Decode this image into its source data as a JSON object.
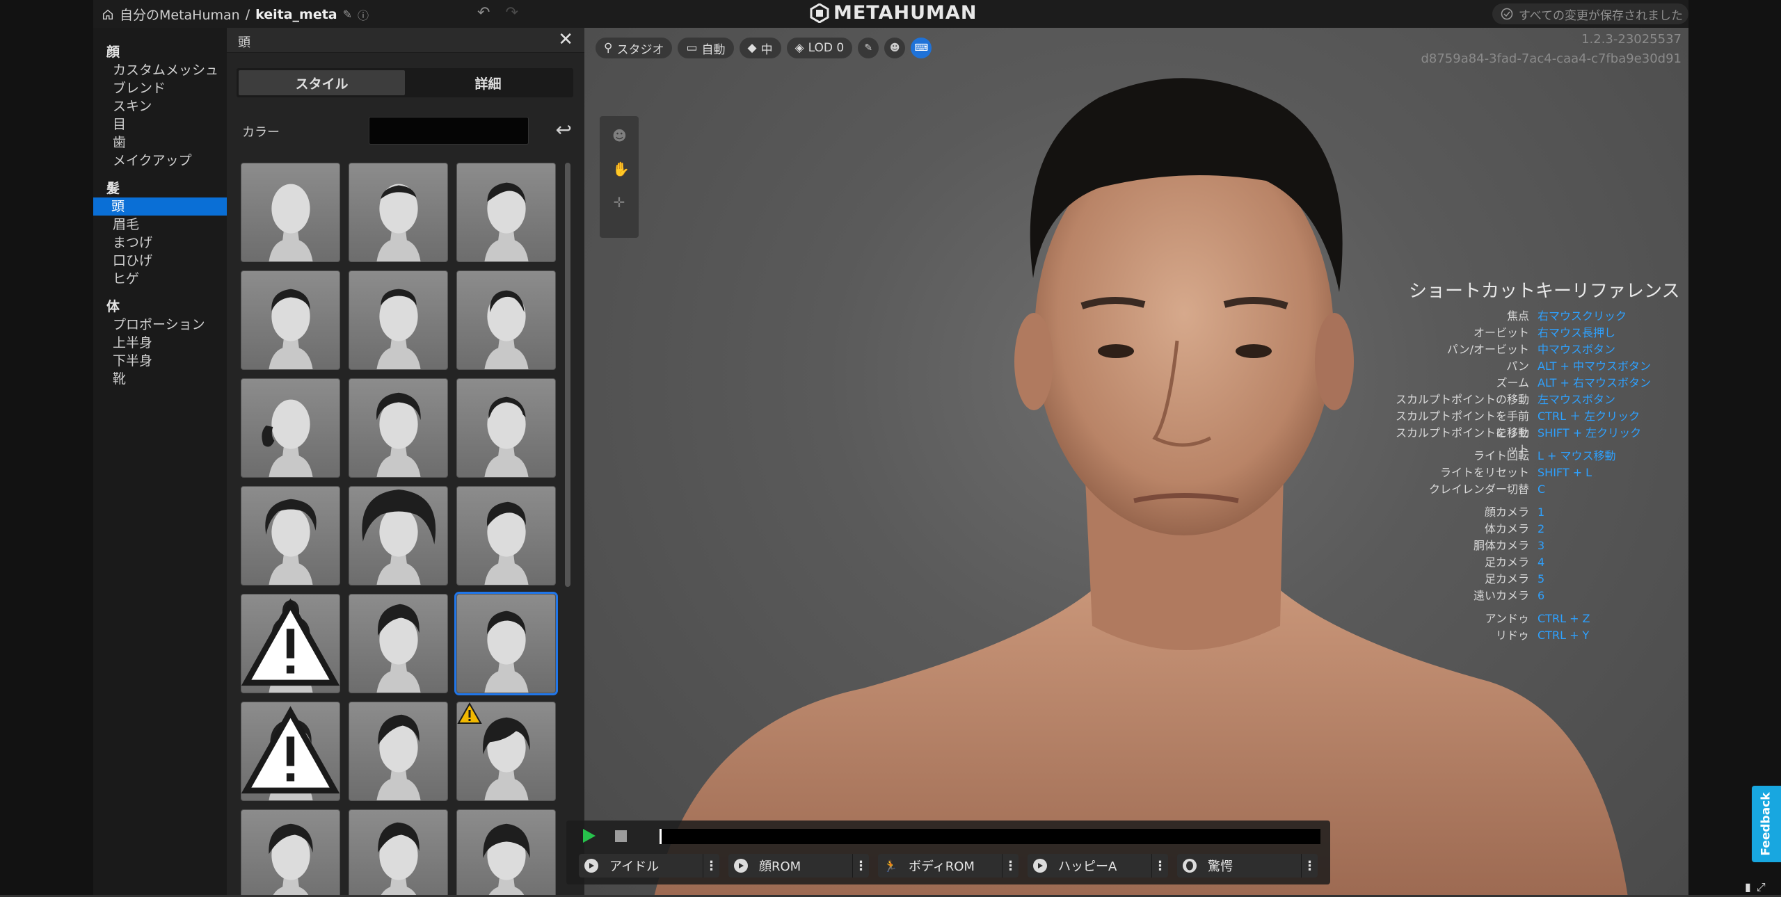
{
  "topbar": {
    "breadcrumb_root": "自分のMetaHuman",
    "separator": "/",
    "project_name": "keita_meta",
    "edit_icon": "pencil-icon",
    "help_icon": "help-circle-icon",
    "undo_icon": "undo-icon",
    "redo_icon": "redo-icon",
    "logo_text": "METAHUMAN",
    "save_status": "すべての変更が保存されました"
  },
  "nav": {
    "sections": [
      {
        "label": "顔",
        "items": [
          {
            "label": "カスタムメッシュ",
            "active": false
          },
          {
            "label": "ブレンド",
            "active": false
          },
          {
            "label": "スキン",
            "active": false
          },
          {
            "label": "目",
            "active": false
          },
          {
            "label": "歯",
            "active": false
          },
          {
            "label": "メイクアップ",
            "active": false
          }
        ]
      },
      {
        "label": "髪",
        "items": [
          {
            "label": "頭",
            "active": true
          },
          {
            "label": "眉毛",
            "active": false
          },
          {
            "label": "まつげ",
            "active": false
          },
          {
            "label": "口ひげ",
            "active": false
          },
          {
            "label": "ヒゲ",
            "active": false
          }
        ]
      },
      {
        "label": "体",
        "items": [
          {
            "label": "プロポーション",
            "active": false
          },
          {
            "label": "上半身",
            "active": false
          },
          {
            "label": "下半身",
            "active": false
          },
          {
            "label": "靴",
            "active": false
          }
        ]
      }
    ]
  },
  "panel": {
    "title": "頭",
    "close_icon": "close-icon",
    "tabs": [
      {
        "label": "スタイル",
        "active": true
      },
      {
        "label": "詳細",
        "active": false
      }
    ],
    "color_label": "カラー",
    "color_value": "#050505",
    "reset_icon": "reset-arrow-icon",
    "hair_tiles": [
      {
        "style": "bald",
        "warning": "none",
        "selected": false
      },
      {
        "style": "thin-short",
        "warning": "none",
        "selected": false
      },
      {
        "style": "side-part",
        "warning": "none",
        "selected": false
      },
      {
        "style": "buzz-dark",
        "warning": "none",
        "selected": false
      },
      {
        "style": "fade",
        "warning": "none",
        "selected": false
      },
      {
        "style": "receding",
        "warning": "none",
        "selected": false
      },
      {
        "style": "bun-side",
        "warning": "none",
        "selected": false
      },
      {
        "style": "curly-short",
        "warning": "none",
        "selected": false
      },
      {
        "style": "cornrows",
        "warning": "none",
        "selected": false
      },
      {
        "style": "curly-medium",
        "warning": "none",
        "selected": false
      },
      {
        "style": "afro",
        "warning": "none",
        "selected": false
      },
      {
        "style": "slicked",
        "warning": "none",
        "selected": false
      },
      {
        "style": "top-knot",
        "warning": "small",
        "selected": false
      },
      {
        "style": "pompadour",
        "warning": "none",
        "selected": false
      },
      {
        "style": "crew-cut",
        "warning": "none",
        "selected": true
      },
      {
        "style": "side-swept",
        "warning": "small",
        "selected": false
      },
      {
        "style": "quiff",
        "warning": "none",
        "selected": false
      },
      {
        "style": "fringe",
        "warning": "large",
        "selected": false
      },
      {
        "style": "wavy",
        "warning": "none",
        "selected": false
      },
      {
        "style": "spiky",
        "warning": "none",
        "selected": false
      },
      {
        "style": "bowl",
        "warning": "none",
        "selected": false
      }
    ]
  },
  "viewport": {
    "toolbar": [
      {
        "icon": "location-pin-icon",
        "label": "スタジオ"
      },
      {
        "icon": "camera-icon",
        "label": "自動"
      },
      {
        "icon": "diamond-icon",
        "label": "中"
      },
      {
        "icon": "layers-icon",
        "label": "LOD 0"
      }
    ],
    "tool_icons": [
      "brush-icon",
      "head-icon",
      "keyboard-icon"
    ],
    "version": "1.2.3-23025537",
    "session_id": "d8759a84-3fad-7ac4-caa4-c7fba9e30d91",
    "side_tools": [
      "face-select-icon",
      "hand-move-icon",
      "move-arrows-icon"
    ]
  },
  "shortcuts": {
    "title": "ショートカットキーリファレンス",
    "groups": [
      [
        {
          "action": "焦点",
          "key": "右マウスクリック"
        },
        {
          "action": "オービット",
          "key": "右マウス長押し"
        },
        {
          "action": "パン/オービット",
          "key": "中マウスボタン"
        },
        {
          "action": "パン",
          "key": "ALT + 中マウスボタン"
        },
        {
          "action": "ズーム",
          "key": "ALT + 右マウスボタン"
        },
        {
          "action": "スカルプトポイントの移動",
          "key": "左マウスボタン"
        },
        {
          "action": "スカルプトポイントを手前に移動",
          "key": "CTRL ＋ 左クリック"
        },
        {
          "action": "スカルプトポイントをリセット",
          "key": "SHIFT + 左クリック"
        }
      ],
      [
        {
          "action": "ライト回転",
          "key": "L + マウス移動"
        },
        {
          "action": "ライトをリセット",
          "key": "SHIFT + L"
        },
        {
          "action": "クレイレンダー切替",
          "key": "C"
        }
      ],
      [
        {
          "action": "顔カメラ",
          "key": "1"
        },
        {
          "action": "体カメラ",
          "key": "2"
        },
        {
          "action": "胴体カメラ",
          "key": "3"
        },
        {
          "action": "足カメラ",
          "key": "4"
        },
        {
          "action": "足カメラ",
          "key": "5"
        },
        {
          "action": "遠いカメラ",
          "key": "6"
        }
      ],
      [
        {
          "action": "アンドゥ",
          "key": "CTRL + Z"
        },
        {
          "action": "リドゥ",
          "key": "CTRL + Y"
        }
      ]
    ]
  },
  "animation": {
    "play_icon": "play-icon",
    "stop_icon": "stop-icon",
    "buttons": [
      {
        "icon": "play-circle-icon",
        "label": "アイドル"
      },
      {
        "icon": "play-circle-icon",
        "label": "顔ROM"
      },
      {
        "icon": "running-icon",
        "label": "ボディROM"
      },
      {
        "icon": "play-circle-icon",
        "label": "ハッピーA"
      },
      {
        "icon": "face-icon",
        "label": "驚愕"
      }
    ],
    "more_icon": "more-vertical-icon"
  },
  "feedback_label": "Feedback",
  "corner_icons": [
    "stats-icon",
    "fullscreen-icon"
  ]
}
